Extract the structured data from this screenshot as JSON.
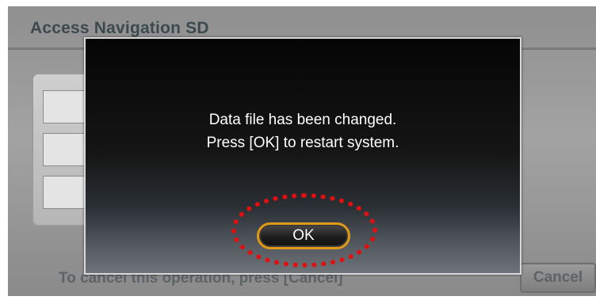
{
  "background": {
    "title": "Access Navigation SD",
    "cancel_hint": "To cancel this operation, press [Cancel]",
    "cancel_button_label": "Cancel"
  },
  "dialog": {
    "message_line1": "Data file has been changed.",
    "message_line2": "Press [OK] to restart system.",
    "ok_label": "OK"
  },
  "colors": {
    "ok_border": "#e09a17",
    "highlight_ring": "#e01010"
  }
}
